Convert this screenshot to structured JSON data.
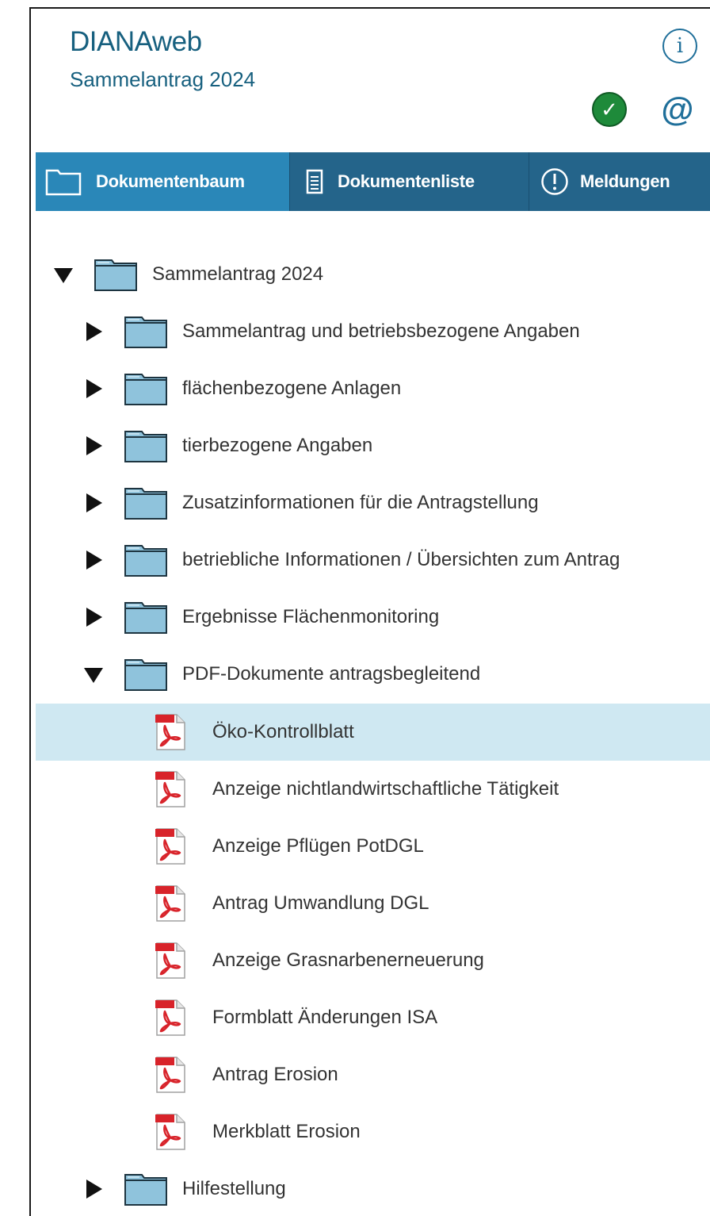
{
  "header": {
    "app_title": "DIANAweb",
    "subtitle": "Sammelantrag 2024",
    "info_icon": "i",
    "at_icon": "@"
  },
  "tabs": [
    {
      "label": "Dokumentenbaum",
      "icon": "folder-icon",
      "active": true
    },
    {
      "label": "Dokumentenliste",
      "icon": "list-icon",
      "active": false
    },
    {
      "label": "Meldungen",
      "icon": "exclamation-icon",
      "active": false
    }
  ],
  "tree": {
    "root": {
      "label": "Sammelantrag 2024",
      "expanded": true
    },
    "folders": [
      {
        "label": "Sammelantrag und betriebsbezogene Angaben",
        "expanded": false
      },
      {
        "label": "flächenbezogene Anlagen",
        "expanded": false
      },
      {
        "label": "tierbezogene Angaben",
        "expanded": false
      },
      {
        "label": "Zusatzinformationen für die Antragstellung",
        "expanded": false
      },
      {
        "label": "betriebliche Informationen / Übersichten zum Antrag",
        "expanded": false
      },
      {
        "label": "Ergebnisse Flächenmonitoring",
        "expanded": false
      },
      {
        "label": "PDF-Dokumente antragsbegleitend",
        "expanded": true
      }
    ],
    "documents": [
      {
        "label": "Öko-Kontrollblatt",
        "selected": true
      },
      {
        "label": "Anzeige nichtlandwirtschaftliche Tätigkeit",
        "selected": false
      },
      {
        "label": "Anzeige Pflügen PotDGL",
        "selected": false
      },
      {
        "label": "Antrag Umwandlung DGL",
        "selected": false
      },
      {
        "label": "Anzeige Grasnarbenerneuerung",
        "selected": false
      },
      {
        "label": "Formblatt Änderungen ISA",
        "selected": false
      },
      {
        "label": "Antrag Erosion",
        "selected": false
      },
      {
        "label": "Merkblatt Erosion",
        "selected": false
      }
    ],
    "last_folder": {
      "label": "Hilfestellung",
      "expanded": false
    }
  },
  "colors": {
    "title": "#17607f",
    "tabbar": "#24648a",
    "tab_active": "#2a87b8",
    "selected_row": "#cfe8f2",
    "folder_fill": "#8fc3dc",
    "pdf_red": "#d8232a"
  }
}
